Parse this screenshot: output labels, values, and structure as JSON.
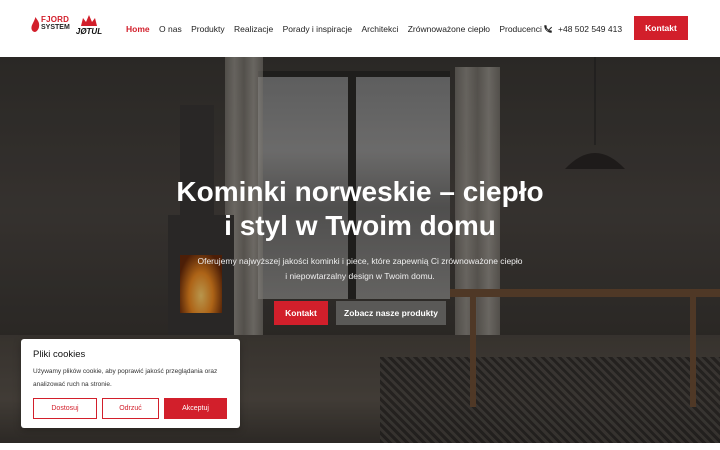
{
  "brand": {
    "logo1_line1": "FJORD",
    "logo1_line2": "SYSTEM",
    "logo2": "JØTUL",
    "accent_color": "#d21f2b"
  },
  "nav": {
    "items": [
      "Home",
      "O nas",
      "Produkty",
      "Realizacje",
      "Porady i inspiracje",
      "Architekci",
      "Zrównoważone ciepło",
      "Producenci"
    ],
    "active": "Home"
  },
  "header": {
    "phone": "+48 502 549 413",
    "contact_button": "Kontakt"
  },
  "hero": {
    "title_line1": "Kominki norweskie – ciepło",
    "title_line2": "i styl w Twoim domu",
    "subtitle_line1": "Oferujemy najwyższej jakości kominki i piece, które zapewnią Ci zrównoważone ciepło",
    "subtitle_line2": "i niepowtarzalny design w Twoim domu.",
    "button_contact": "Kontakt",
    "button_products": "Zobacz nasze produkty"
  },
  "cookie": {
    "title": "Pliki cookies",
    "text": "Używamy plików cookie, aby poprawić jakość przeglądania oraz analizować ruch na stronie.",
    "btn_customize": "Dostosuj",
    "btn_reject": "Odrzuć",
    "btn_accept": "Akceptuj"
  }
}
